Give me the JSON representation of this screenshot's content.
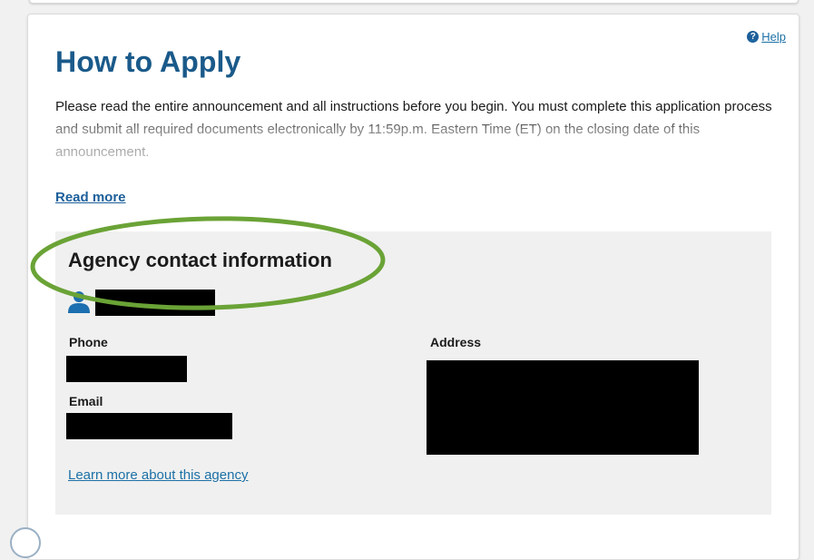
{
  "help": {
    "label": "Help",
    "icon": "question-circle-icon",
    "icon_glyph": "?"
  },
  "how_to_apply": {
    "title": "How to Apply",
    "intro_text": "Please read the entire announcement and all instructions before you begin. You must complete this application process and submit all required documents electronically by 11:59p.m. Eastern Time (ET) on the closing date of this announcement.",
    "read_more_label": "Read more"
  },
  "agency_contact": {
    "heading": "Agency contact information",
    "contact_icon": "person-icon",
    "phone_label": "Phone",
    "email_label": "Email",
    "address_label": "Address",
    "learn_more_label": "Learn more about this agency"
  },
  "colors": {
    "title": "#1a5a8a",
    "link": "#1c70a6",
    "annotation_circle": "#6aa336",
    "contact_box_bg": "#f0f0f0"
  }
}
